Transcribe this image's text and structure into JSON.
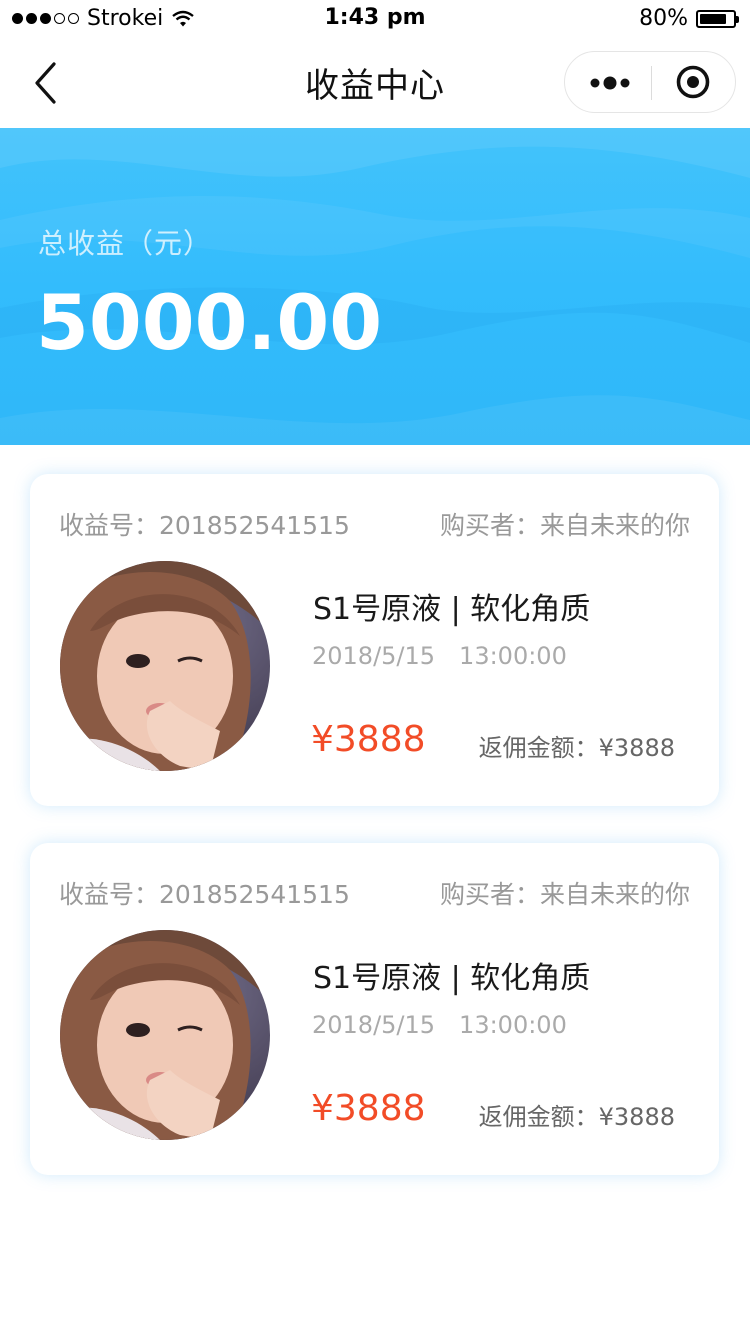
{
  "status_bar": {
    "carrier": "Strokei",
    "time": "1:43 pm",
    "battery": "80%",
    "battery_level": 0.8,
    "signal_filled": 3,
    "signal_total": 5
  },
  "nav": {
    "title": "收益中心",
    "back_icon": "chevron-left-icon",
    "more_icon": "more-dots-icon",
    "target_icon": "target-icon"
  },
  "summary": {
    "label": "总收益（元）",
    "amount": "5000.00"
  },
  "orders": [
    {
      "order_label": "收益号：201852541515",
      "buyer_label": "购买者：来自未来的你",
      "product": "S1号原液 | 软化角质",
      "date": "2018/5/15　13:00:00",
      "price": "¥3888",
      "rebate": "返佣金额：¥3888"
    },
    {
      "order_label": "收益号：201852541515",
      "buyer_label": "购买者：来自未来的你",
      "product": "S1号原液 | 软化角质",
      "date": "2018/5/15　13:00:00",
      "price": "¥3888",
      "rebate": "返佣金额：¥3888"
    }
  ],
  "colors": {
    "banner": "#37bdfb",
    "price": "#f24c27",
    "muted": "#999999"
  }
}
